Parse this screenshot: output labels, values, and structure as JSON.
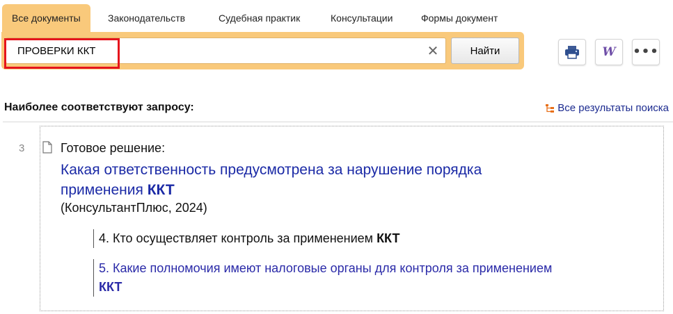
{
  "tabs": [
    {
      "label": "Все документы",
      "active": true
    },
    {
      "label": "Законодательств",
      "active": false
    },
    {
      "label": "Судебная практик",
      "active": false
    },
    {
      "label": "Консультации",
      "active": false
    },
    {
      "label": "Формы документ",
      "active": false
    }
  ],
  "search": {
    "value": "ПРОВЕРКИ ККТ",
    "clear_icon": "close-icon",
    "find_label": "Найти"
  },
  "toolbar": {
    "icons": [
      "print-icon",
      "word-export-icon",
      "more-icon"
    ],
    "word_glyph": "W",
    "more_glyph": "•••"
  },
  "results": {
    "heading": "Наиболее соответствуют запросу:",
    "all_results_label": "Все результаты поиска",
    "items": [
      {
        "number": "3",
        "type": "Готовое решение:",
        "title_prefix": "Какая ответственность предусмотрена за нарушение порядка применения ",
        "title_keyword": "ККТ",
        "source": "(КонсультантПлюс, 2024)",
        "subitems": [
          {
            "prefix": "4. Кто осуществляет контроль за применением ",
            "keyword": "ККТ",
            "is_link": false
          },
          {
            "prefix": "5. Какие полномочия имеют налоговые органы для контроля за применением ",
            "keyword": "ККТ",
            "is_link": true
          }
        ]
      }
    ]
  },
  "colors": {
    "accent": "#f9c97b",
    "link": "#1b2aa6",
    "highlight": "#e5141c"
  }
}
